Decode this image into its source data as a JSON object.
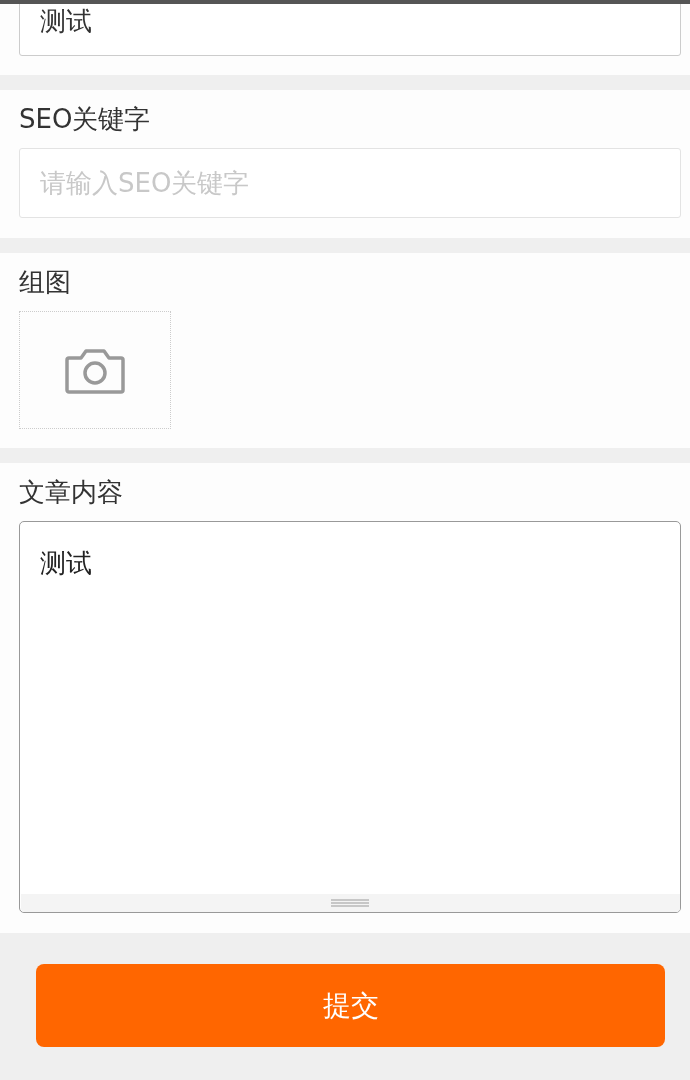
{
  "fields": [
    {
      "kind": "text",
      "value": "测试"
    },
    {
      "kind": "text",
      "label": "SEO关键字",
      "placeholder": "请输入SEO关键字"
    },
    {
      "kind": "images",
      "label": "组图"
    },
    {
      "kind": "textarea",
      "label": "文章内容",
      "value": "测试"
    }
  ],
  "submit_button": "提交"
}
